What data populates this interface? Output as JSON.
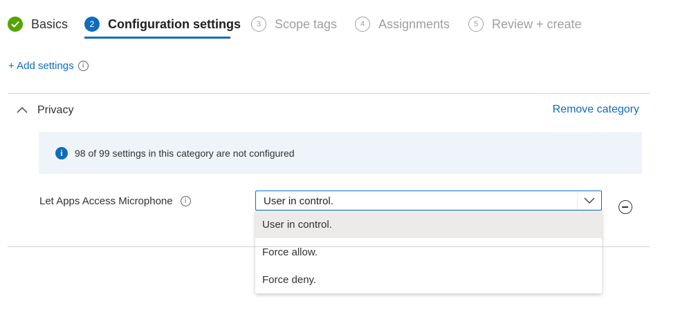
{
  "wizard": {
    "steps": [
      {
        "label": "Basics",
        "marker": "",
        "state": "done"
      },
      {
        "label": "Configuration settings",
        "marker": "2",
        "state": "active"
      },
      {
        "label": "Scope tags",
        "marker": "3",
        "state": "todo"
      },
      {
        "label": "Assignments",
        "marker": "4",
        "state": "todo"
      },
      {
        "label": "Review + create",
        "marker": "5",
        "state": "todo"
      }
    ]
  },
  "add_settings_label": "+ Add settings",
  "category": {
    "title": "Privacy",
    "remove_label": "Remove category",
    "banner_text": "98 of 99 settings in this category are not configured"
  },
  "setting": {
    "label": "Let Apps Access Microphone",
    "value": "User in control.",
    "options": [
      "User in control.",
      "Force allow.",
      "Force deny."
    ]
  },
  "colors": {
    "accent": "#0f6cbd",
    "success": "#57a300",
    "banner_bg": "#eff4fa",
    "option_selected": "#edebe9"
  },
  "icons": [
    "checkmark-icon",
    "info-icon",
    "chevron-up-icon",
    "chevron-down-icon",
    "remove-circle-icon"
  ]
}
